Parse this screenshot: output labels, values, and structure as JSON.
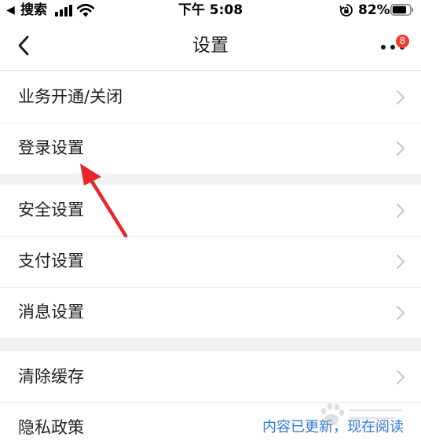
{
  "status_bar": {
    "back_glyph": "◀",
    "back_app": "搜索",
    "time": "下午 5:08",
    "battery_percent": "82%",
    "battery_level": 0.82
  },
  "nav": {
    "title": "设置",
    "back_icon": "chevron-left-icon",
    "more_icon": "more-dots-icon",
    "badge_count": "8"
  },
  "groups": [
    {
      "items": [
        {
          "label": "业务开通/关闭"
        },
        {
          "label": "登录设置"
        }
      ]
    },
    {
      "items": [
        {
          "label": "安全设置"
        },
        {
          "label": "支付设置"
        },
        {
          "label": "消息设置"
        }
      ]
    },
    {
      "items": [
        {
          "label": "清除缓存"
        },
        {
          "label": "隐私政策",
          "extra": "内容已更新，现在阅读"
        }
      ]
    }
  ],
  "colors": {
    "background": "#f2f2f4",
    "link": "#2f78d4",
    "badge": "#f23b2f",
    "annotation_arrow": "#e8272a"
  }
}
